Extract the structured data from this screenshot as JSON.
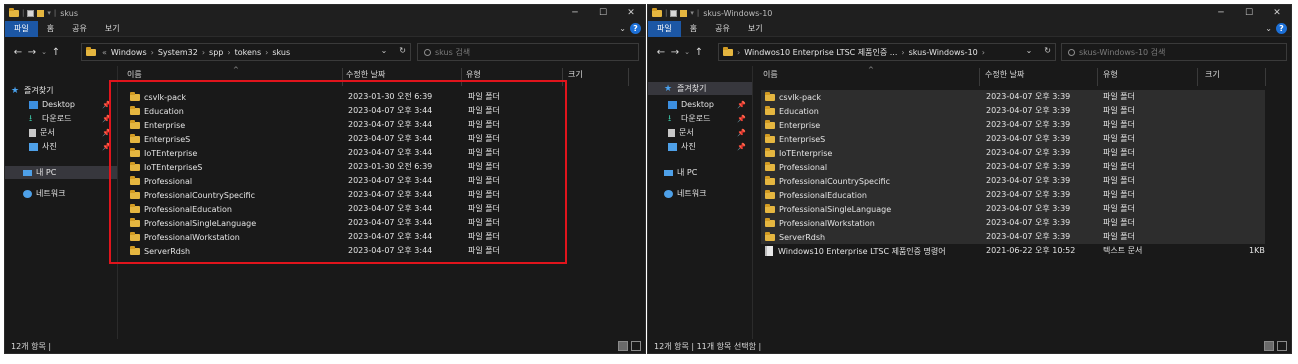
{
  "left": {
    "title": "skus",
    "window_controls": [
      "─",
      "☐",
      "✕"
    ],
    "ribbon_tabs": [
      "파일",
      "홈",
      "공유",
      "보기"
    ],
    "breadcrumbs": [
      "Windows",
      "System32",
      "spp",
      "tokens",
      "skus"
    ],
    "breadcrumb_prefix": "«",
    "search_placeholder": "skus 검색",
    "sidebar": [
      {
        "label": "즐겨찾기",
        "icon": "star-icon"
      },
      {
        "label": "Desktop",
        "icon": "desktop-icon",
        "pinned": true
      },
      {
        "label": "다운로드",
        "icon": "download-icon",
        "pinned": true
      },
      {
        "label": "문서",
        "icon": "document-icon",
        "pinned": true
      },
      {
        "label": "사진",
        "icon": "pictures-icon",
        "pinned": true
      },
      {
        "label": "내 PC",
        "icon": "pc-icon",
        "selected": true
      },
      {
        "label": "네트워크",
        "icon": "network-icon"
      }
    ],
    "columns": [
      "이름",
      "수정한 날짜",
      "유형",
      "크기"
    ],
    "rows": [
      {
        "name": "csvlk-pack",
        "date": "2023-01-30 오전 6:39",
        "type": "파일 폴더",
        "size": ""
      },
      {
        "name": "Education",
        "date": "2023-04-07 오후 3:44",
        "type": "파일 폴더",
        "size": ""
      },
      {
        "name": "Enterprise",
        "date": "2023-04-07 오후 3:44",
        "type": "파일 폴더",
        "size": ""
      },
      {
        "name": "EnterpriseS",
        "date": "2023-04-07 오후 3:44",
        "type": "파일 폴더",
        "size": ""
      },
      {
        "name": "IoTEnterprise",
        "date": "2023-04-07 오후 3:44",
        "type": "파일 폴더",
        "size": ""
      },
      {
        "name": "IoTEnterpriseS",
        "date": "2023-01-30 오전 6:39",
        "type": "파일 폴더",
        "size": ""
      },
      {
        "name": "Professional",
        "date": "2023-04-07 오후 3:44",
        "type": "파일 폴더",
        "size": ""
      },
      {
        "name": "ProfessionalCountrySpecific",
        "date": "2023-04-07 오후 3:44",
        "type": "파일 폴더",
        "size": ""
      },
      {
        "name": "ProfessionalEducation",
        "date": "2023-04-07 오후 3:44",
        "type": "파일 폴더",
        "size": ""
      },
      {
        "name": "ProfessionalSingleLanguage",
        "date": "2023-04-07 오후 3:44",
        "type": "파일 폴더",
        "size": ""
      },
      {
        "name": "ProfessionalWorkstation",
        "date": "2023-04-07 오후 3:44",
        "type": "파일 폴더",
        "size": ""
      },
      {
        "name": "ServerRdsh",
        "date": "2023-04-07 오후 3:44",
        "type": "파일 폴더",
        "size": ""
      }
    ],
    "status": "12개 항목  |"
  },
  "right": {
    "title": "skus-Windows-10",
    "window_controls": [
      "─",
      "☐",
      "✕"
    ],
    "ribbon_tabs": [
      "파일",
      "홈",
      "공유",
      "보기"
    ],
    "breadcrumbs": [
      "Windwos10 Enterprise LTSC 제품인증 ...",
      "skus-Windows-10"
    ],
    "search_placeholder": "skus-Windows-10 검색",
    "sidebar": [
      {
        "label": "즐겨찾기",
        "icon": "star-icon"
      },
      {
        "label": "Desktop",
        "icon": "desktop-icon",
        "pinned": true
      },
      {
        "label": "다운로드",
        "icon": "download-icon",
        "pinned": true
      },
      {
        "label": "문서",
        "icon": "document-icon",
        "pinned": true
      },
      {
        "label": "사진",
        "icon": "pictures-icon",
        "pinned": true
      },
      {
        "label": "내 PC",
        "icon": "pc-icon"
      },
      {
        "label": "네트워크",
        "icon": "network-icon"
      }
    ],
    "columns": [
      "이름",
      "수정한 날짜",
      "유형",
      "크기"
    ],
    "rows": [
      {
        "name": "csvlk-pack",
        "date": "2023-04-07 오후 3:39",
        "type": "파일 폴더",
        "size": "",
        "kind": "folder"
      },
      {
        "name": "Education",
        "date": "2023-04-07 오후 3:39",
        "type": "파일 폴더",
        "size": "",
        "kind": "folder"
      },
      {
        "name": "Enterprise",
        "date": "2023-04-07 오후 3:39",
        "type": "파일 폴더",
        "size": "",
        "kind": "folder"
      },
      {
        "name": "EnterpriseS",
        "date": "2023-04-07 오후 3:39",
        "type": "파일 폴더",
        "size": "",
        "kind": "folder"
      },
      {
        "name": "IoTEnterprise",
        "date": "2023-04-07 오후 3:39",
        "type": "파일 폴더",
        "size": "",
        "kind": "folder"
      },
      {
        "name": "Professional",
        "date": "2023-04-07 오후 3:39",
        "type": "파일 폴더",
        "size": "",
        "kind": "folder"
      },
      {
        "name": "ProfessionalCountrySpecific",
        "date": "2023-04-07 오후 3:39",
        "type": "파일 폴더",
        "size": "",
        "kind": "folder"
      },
      {
        "name": "ProfessionalEducation",
        "date": "2023-04-07 오후 3:39",
        "type": "파일 폴더",
        "size": "",
        "kind": "folder"
      },
      {
        "name": "ProfessionalSingleLanguage",
        "date": "2023-04-07 오후 3:39",
        "type": "파일 폴더",
        "size": "",
        "kind": "folder"
      },
      {
        "name": "ProfessionalWorkstation",
        "date": "2023-04-07 오후 3:39",
        "type": "파일 폴더",
        "size": "",
        "kind": "folder"
      },
      {
        "name": "ServerRdsh",
        "date": "2023-04-07 오후 3:39",
        "type": "파일 폴더",
        "size": "",
        "kind": "folder"
      },
      {
        "name": "Windows10 Enterprise LTSC 제품인증 명령어",
        "date": "2021-06-22 오후 10:52",
        "type": "텍스트 문서",
        "size": "1KB",
        "kind": "text"
      }
    ],
    "status": "12개 항목  |  11개 항목 선택함  |"
  },
  "colors": {
    "highlight_box": "#e0141c",
    "file_tab": "#1c57a5",
    "folder": "#e5b640"
  }
}
